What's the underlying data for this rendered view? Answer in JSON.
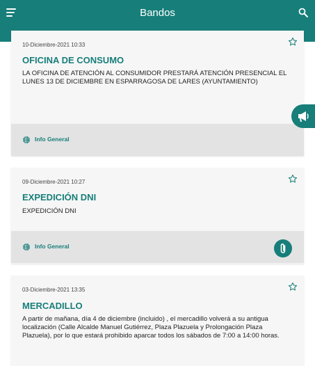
{
  "header": {
    "title": "Bandos",
    "menu_icon": "menu-icon",
    "search_icon": "search-icon"
  },
  "colors": {
    "accent": "#177e7a",
    "card_bg": "#f6f6f6",
    "footer_bg": "#e3e3e3"
  },
  "cards": [
    {
      "date": "10-Diciembre-2021 10:33",
      "title": "OFICINA DE CONSUMO",
      "body": "LA OFICINA DE ATENCIÓN AL CONSUMIDOR PRESTARÁ ATENCIÓN PRESENCIAL EL LUNES 13 DE DICIEMBRE EN ESPARRAGOSA DE LARES (AYUNTAMIENTO)",
      "category": "Info General"
    },
    {
      "date": "09-Diciembre-2021 10:27",
      "title": "EXPEDICIÓN DNI",
      "body": "EXPEDICIÓN DNI",
      "category": "Info General"
    },
    {
      "date": "03-Diciembre-2021 13:35",
      "title": "MERCADILLO",
      "body": "A partir de mañana, día 4 de diciembre (incluido) , el mercadillo volverá a su antigua localización (Calle Alcalde Manuel Gutiérrez, Plaza Plazuela y Prolongación Plaza Plazuela), por lo que estará prohibido aparcar todos los sábados de 7:00 a 14:00 horas."
    }
  ]
}
